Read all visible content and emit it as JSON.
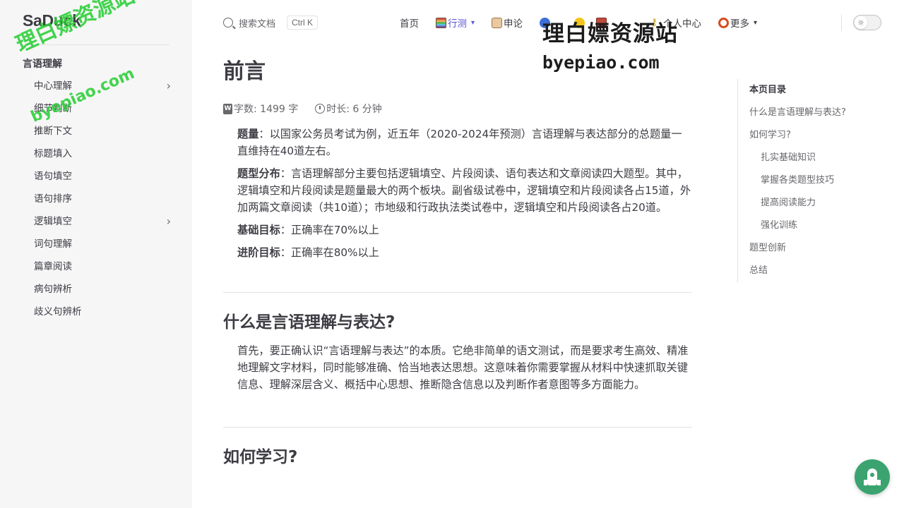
{
  "site": {
    "logo": "SaDuck"
  },
  "search": {
    "label": "搜索文档",
    "shortcut": "Ctrl K"
  },
  "nav": {
    "items": [
      {
        "label": "首页",
        "icon": "",
        "active": false,
        "dropdown": false
      },
      {
        "label": "行测",
        "icon": "abacus-icon",
        "active": true,
        "dropdown": true
      },
      {
        "label": "申论",
        "icon": "scroll-icon",
        "active": false,
        "dropdown": false
      },
      {
        "label": "公...",
        "icon": "blob-icon",
        "active": false,
        "dropdown": false
      },
      {
        "label": "...",
        "icon": "face-icon",
        "active": false,
        "dropdown": false
      },
      {
        "label": "...",
        "icon": "book-icon",
        "active": false,
        "dropdown": false
      },
      {
        "label": "个人中心",
        "icon": "key-icon",
        "active": false,
        "dropdown": false
      },
      {
        "label": "更多",
        "icon": "ring-icon",
        "active": false,
        "dropdown": true
      }
    ],
    "accent": "#5b54d6"
  },
  "watermark": {
    "title": "理白嫖资源站",
    "url": "byepiao.com"
  },
  "sidebar": {
    "group": "言语理解",
    "items": [
      {
        "label": "中心理解",
        "expandable": true
      },
      {
        "label": "细节判断",
        "expandable": false
      },
      {
        "label": "推断下文",
        "expandable": false
      },
      {
        "label": "标题填入",
        "expandable": false
      },
      {
        "label": "语句填空",
        "expandable": false
      },
      {
        "label": "语句排序",
        "expandable": false
      },
      {
        "label": "逻辑填空",
        "expandable": true
      },
      {
        "label": "词句理解",
        "expandable": false
      },
      {
        "label": "篇章阅读",
        "expandable": false
      },
      {
        "label": "病句辨析",
        "expandable": false
      },
      {
        "label": "歧义句辨析",
        "expandable": false
      }
    ]
  },
  "article": {
    "title": "前言",
    "word_count": "字数: 1499 字",
    "duration": "时长: 6 分钟",
    "intro": [
      {
        "key": "题量",
        "text": "：以国家公务员考试为例，近五年（2020-2024年预测）言语理解与表达部分的总题量一直维持在40道左右。"
      },
      {
        "key": "题型分布",
        "text": "：言语理解部分主要包括逻辑填空、片段阅读、语句表达和文章阅读四大题型。其中，逻辑填空和片段阅读是题量最大的两个板块。副省级试卷中，逻辑填空和片段阅读各占15道，外加两篇文章阅读（共10道）；市地级和行政执法类试卷中，逻辑填空和片段阅读各占20道。"
      },
      {
        "key": "基础目标",
        "text": "：正确率在70%以上"
      },
      {
        "key": "进阶目标",
        "text": "：正确率在80%以上"
      }
    ],
    "section1": {
      "heading": "什么是言语理解与表达?",
      "text": "首先，要正确认识“言语理解与表达”的本质。它绝非简单的语文测试，而是要求考生高效、精准地理解文字材料，同时能够准确、恰当地表达思想。这意味着你需要掌握从材料中快速抓取关键信息、理解深层含义、概括中心思想、推断隐含信息以及判断作者意图等多方面能力。"
    },
    "section2": {
      "heading": "如何学习?"
    }
  },
  "toc": {
    "title": "本页目录",
    "items": [
      {
        "label": "什么是言语理解与表达?",
        "level": 1
      },
      {
        "label": "如何学习?",
        "level": 1
      },
      {
        "label": "扎实基础知识",
        "level": 2
      },
      {
        "label": "掌握各类题型技巧",
        "level": 2
      },
      {
        "label": "提高阅读能力",
        "level": 2
      },
      {
        "label": "强化训练",
        "level": 2
      },
      {
        "label": "题型创新",
        "level": 1
      },
      {
        "label": "总结",
        "level": 1
      }
    ]
  },
  "fab": {
    "icon": "rocket-icon",
    "color": "#3aa36f"
  }
}
